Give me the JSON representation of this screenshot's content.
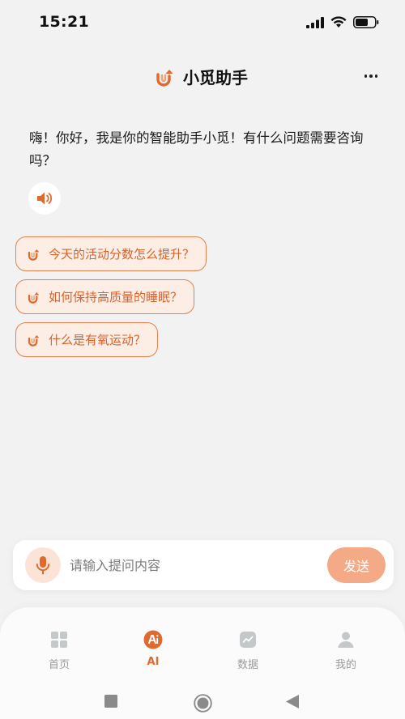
{
  "status_bar": {
    "time": "15:21"
  },
  "header": {
    "title": "小觅助手",
    "more_label": "更多"
  },
  "chat": {
    "greeting": "嗨！你好，我是你的智能助手小觅！有什么问题需要咨询吗？",
    "suggestions": [
      {
        "label": "今天的活动分数怎么提升？"
      },
      {
        "label": "如何保持高质量的睡眠？"
      },
      {
        "label": "什么是有氧运动？"
      }
    ]
  },
  "input": {
    "placeholder": "请输入提问内容",
    "value": "",
    "send_label": "发送"
  },
  "tab_bar": {
    "tabs": [
      {
        "label": "首页",
        "icon": "grid-icon",
        "active": false
      },
      {
        "label": "AI",
        "icon": "ai-icon",
        "active": true
      },
      {
        "label": "数据",
        "icon": "chart-icon",
        "active": false
      },
      {
        "label": "我的",
        "icon": "person-icon",
        "active": false
      }
    ]
  },
  "colors": {
    "accent": "#e06a2e",
    "chip_bg": "#fdeee5",
    "chip_border": "#e2814f",
    "send_bg": "#f4a987",
    "page_bg": "#f2f2f2"
  }
}
